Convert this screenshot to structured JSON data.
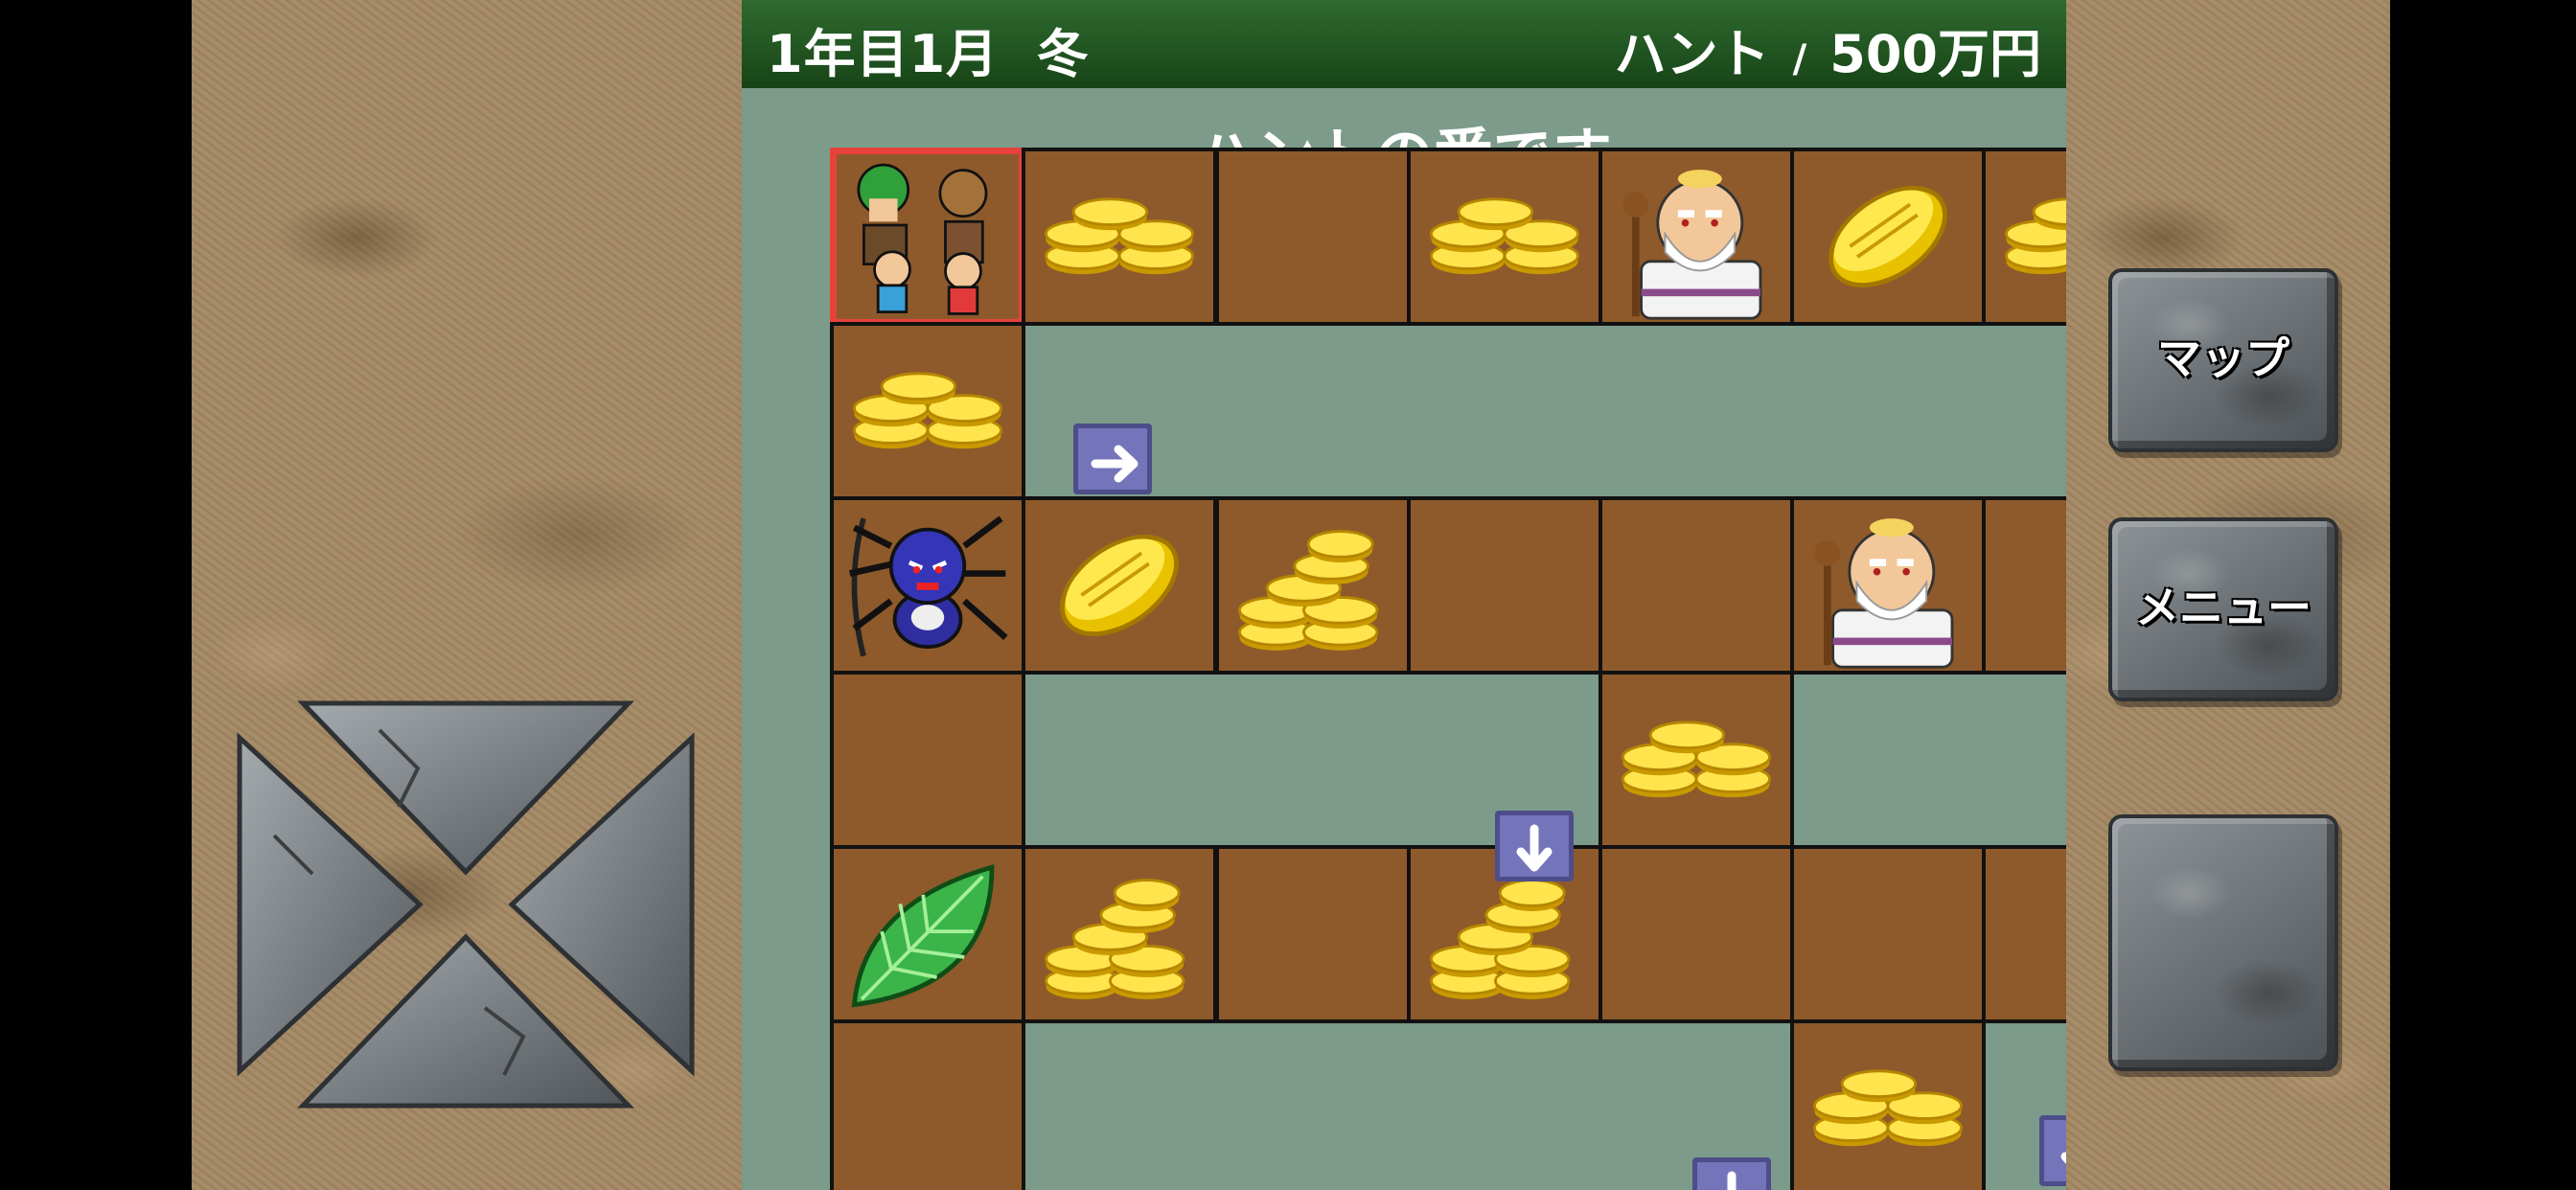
{
  "header": {
    "date": "1年目1月",
    "season": "冬",
    "player_name": "ハント",
    "separator": "/",
    "money": "500万円"
  },
  "turn_message": "ハントの番です",
  "buttons": {
    "map": "マップ",
    "menu": "メニュー"
  },
  "board": {
    "cells": [
      {
        "row": 0,
        "col": 0,
        "content": "players",
        "current": true
      },
      {
        "row": 0,
        "col": 1,
        "content": "coin-pile"
      },
      {
        "row": 0,
        "col": 2,
        "content": "empty"
      },
      {
        "row": 0,
        "col": 3,
        "content": "coin-pile"
      },
      {
        "row": 0,
        "col": 4,
        "content": "old-man"
      },
      {
        "row": 0,
        "col": 5,
        "content": "gold-bar"
      },
      {
        "row": 0,
        "col": 6,
        "content": "coin-pile"
      },
      {
        "row": 1,
        "col": 0,
        "content": "coin-pile"
      },
      {
        "row": 2,
        "col": 0,
        "content": "spider-monster"
      },
      {
        "row": 2,
        "col": 1,
        "content": "gold-bar"
      },
      {
        "row": 2,
        "col": 2,
        "content": "coin-stack"
      },
      {
        "row": 2,
        "col": 3,
        "content": "empty"
      },
      {
        "row": 2,
        "col": 4,
        "content": "empty"
      },
      {
        "row": 2,
        "col": 5,
        "content": "old-man"
      },
      {
        "row": 2,
        "col": 6,
        "content": "empty"
      },
      {
        "row": 3,
        "col": 0,
        "content": "empty"
      },
      {
        "row": 3,
        "col": 4,
        "content": "coin-pile"
      },
      {
        "row": 4,
        "col": 0,
        "content": "leaf"
      },
      {
        "row": 4,
        "col": 1,
        "content": "coin-stack"
      },
      {
        "row": 4,
        "col": 2,
        "content": "empty"
      },
      {
        "row": 4,
        "col": 3,
        "content": "coin-stack"
      },
      {
        "row": 4,
        "col": 4,
        "content": "empty"
      },
      {
        "row": 4,
        "col": 5,
        "content": "empty"
      },
      {
        "row": 4,
        "col": 6,
        "content": "empty"
      },
      {
        "row": 5,
        "col": 0,
        "content": "empty"
      },
      {
        "row": 5,
        "col": 5,
        "content": "coin-pile"
      }
    ],
    "arrows": [
      {
        "direction": "right"
      },
      {
        "direction": "down"
      },
      {
        "direction": "down"
      },
      {
        "direction": "down"
      }
    ]
  },
  "colors": {
    "board_background": "#7c9b8a",
    "cell": "#8e5a2b",
    "current_cell_border": "#e8413c",
    "header": "#1f521f",
    "arrow_tile": "#7474ba"
  }
}
